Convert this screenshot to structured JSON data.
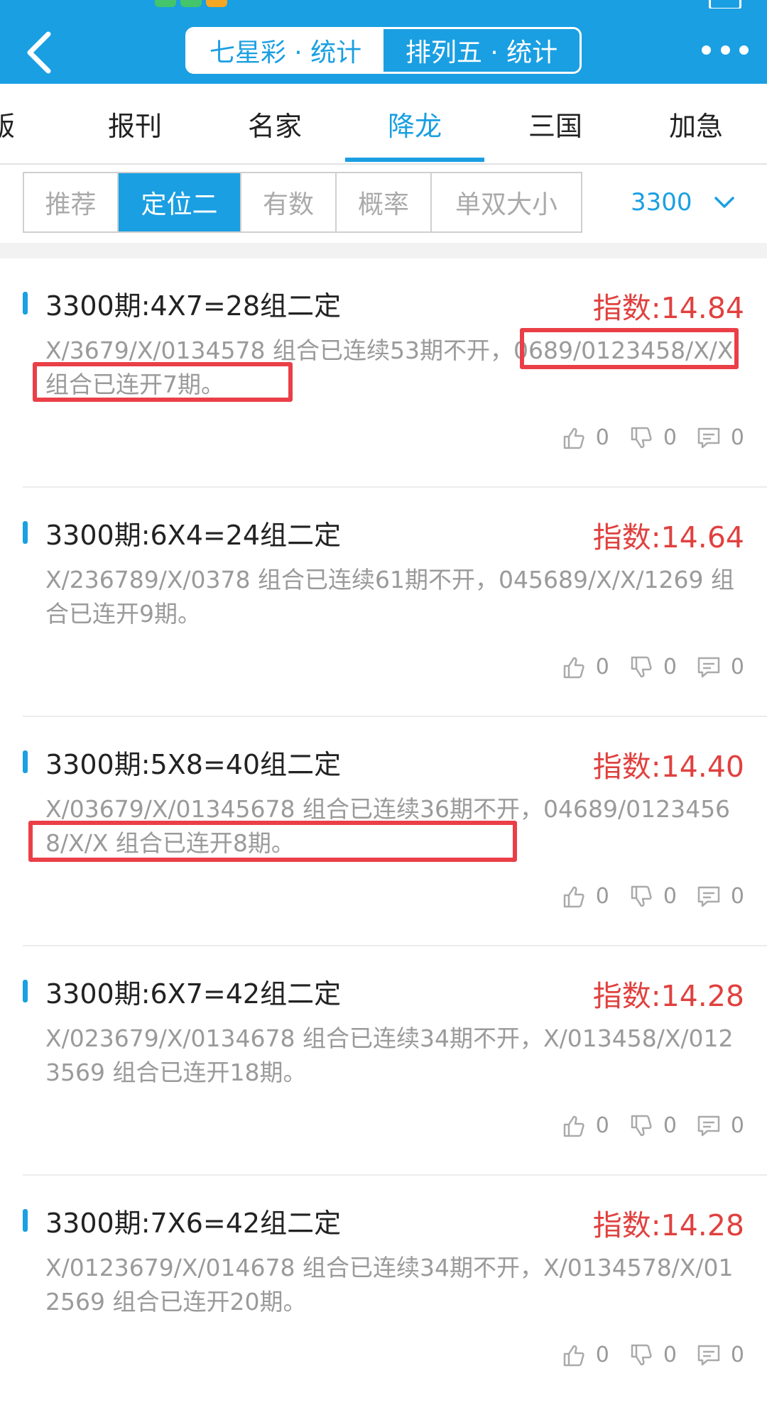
{
  "header": {
    "tabs": [
      {
        "label": "七星彩 · 统计",
        "active": false
      },
      {
        "label": "排列五 · 统计",
        "active": true
      }
    ]
  },
  "category_tabs": [
    {
      "label": "版",
      "active": false
    },
    {
      "label": "报刊",
      "active": false
    },
    {
      "label": "名家",
      "active": false
    },
    {
      "label": "降龙",
      "active": true
    },
    {
      "label": "三国",
      "active": false
    },
    {
      "label": "加急",
      "active": false
    }
  ],
  "filters": [
    {
      "label": "推荐",
      "active": false
    },
    {
      "label": "定位二",
      "active": true
    },
    {
      "label": "有数",
      "active": false
    },
    {
      "label": "概率",
      "active": false
    },
    {
      "label": "单双大小",
      "active": false
    }
  ],
  "period_select": {
    "value": "3300"
  },
  "posts": [
    {
      "title": "3300期:4X7=28组二定",
      "index": "指数:14.84",
      "desc": "X/3679/X/0134578 组合已连续53期不开，0689/0123458/X/X 组合已连开7期。",
      "likes": "0",
      "dislikes": "0",
      "comments": "0"
    },
    {
      "title": "3300期:6X4=24组二定",
      "index": "指数:14.64",
      "desc": "X/236789/X/0378 组合已连续61期不开，045689/X/X/1269 组合已连开9期。",
      "likes": "0",
      "dislikes": "0",
      "comments": "0"
    },
    {
      "title": "3300期:5X8=40组二定",
      "index": "指数:14.40",
      "desc": "X/03679/X/01345678 组合已连续36期不开，04689/01234568/X/X 组合已连开8期。",
      "likes": "0",
      "dislikes": "0",
      "comments": "0"
    },
    {
      "title": "3300期:6X7=42组二定",
      "index": "指数:14.28",
      "desc": "X/023679/X/0134678 组合已连续34期不开，X/013458/X/0123569 组合已连开18期。",
      "likes": "0",
      "dislikes": "0",
      "comments": "0"
    },
    {
      "title": "3300期:7X6=42组二定",
      "index": "指数:14.28",
      "desc": "X/0123679/X/014678 组合已连续34期不开，X/0134578/X/012569 组合已连开20期。",
      "likes": "0",
      "dislikes": "0",
      "comments": "0"
    }
  ],
  "colors": {
    "primary": "#1a9fe2",
    "index_red": "#e0413f",
    "highlight_red": "#ea3f47",
    "muted_text": "#9a9a9a"
  }
}
